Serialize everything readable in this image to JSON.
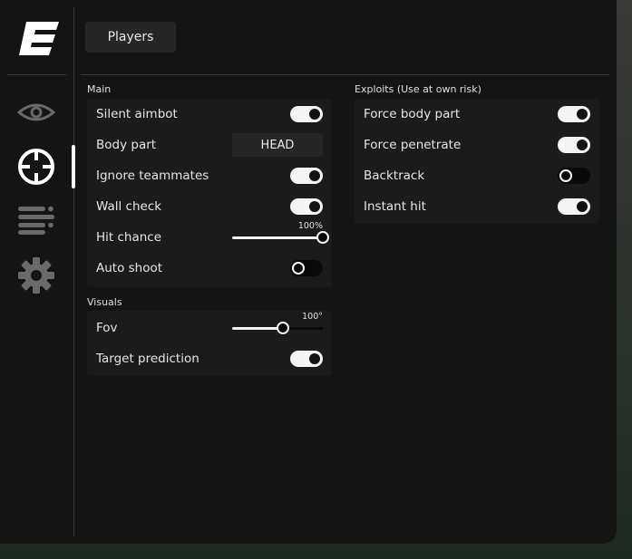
{
  "tabs": {
    "active": "Players"
  },
  "nav": [
    {
      "icon": "eye-icon"
    },
    {
      "icon": "crosshair-icon"
    },
    {
      "icon": "list-icon"
    },
    {
      "icon": "gear-icon"
    }
  ],
  "main": {
    "label": "Main",
    "silent_aimbot": {
      "label": "Silent aimbot",
      "on": true
    },
    "body_part": {
      "label": "Body part",
      "value": "HEAD"
    },
    "ignore_teammates": {
      "label": "Ignore teammates",
      "on": true
    },
    "wall_check": {
      "label": "Wall check",
      "on": true
    },
    "hit_chance": {
      "label": "Hit chance",
      "value": 100,
      "display": "100%"
    },
    "auto_shoot": {
      "label": "Auto shoot",
      "on": false
    }
  },
  "visuals": {
    "label": "Visuals",
    "fov": {
      "label": "Fov",
      "value": 0.56,
      "display": "100°"
    },
    "target_prediction": {
      "label": "Target prediction",
      "on": true
    }
  },
  "exploits": {
    "label": "Exploits (Use at own risk)",
    "force_body_part": {
      "label": "Force body part",
      "on": true
    },
    "force_penetrate": {
      "label": "Force penetrate",
      "on": true
    },
    "backtrack": {
      "label": "Backtrack",
      "on": false
    },
    "instant_hit": {
      "label": "Instant hit",
      "on": true
    }
  },
  "colors": {
    "panel": "#141414",
    "group": "#1b1b1b",
    "accent": "#f4f4f4"
  }
}
